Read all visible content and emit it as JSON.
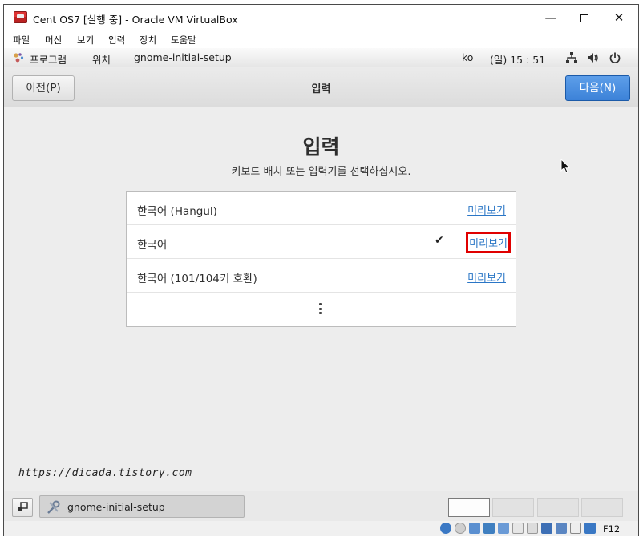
{
  "window": {
    "title": "Cent OS7 [실행 중] - Oracle VM VirtualBox",
    "minimize": "—",
    "close": "✕"
  },
  "menubar": {
    "items": [
      "파일",
      "머신",
      "보기",
      "입력",
      "장치",
      "도움말"
    ]
  },
  "gnome_panel": {
    "applications": "프로그램",
    "places": "위치",
    "active_app": "gnome-initial-setup",
    "input_method": "ko",
    "clock": "(일) 15 : 51",
    "icons": [
      "network-icon",
      "volume-icon",
      "power-icon"
    ]
  },
  "headerbar": {
    "prev_label": "이전(P)",
    "title": "입력",
    "next_label": "다음(N)"
  },
  "page": {
    "heading": "입력",
    "description": "키보드 배치 또는 입력기를 선택하십시오."
  },
  "input_list": [
    {
      "label": "한국어 (Hangul)",
      "preview": "미리보기",
      "selected": false
    },
    {
      "label": "한국어",
      "preview": "미리보기",
      "selected": true
    },
    {
      "label": "한국어 (101/104키 호환)",
      "preview": "미리보기",
      "selected": false
    }
  ],
  "checkmark": "✔",
  "watermark": "https://dicada.tistory.com",
  "taskbar": {
    "item_label": "gnome-initial-setup"
  },
  "statusbar": {
    "host_key": "F12"
  },
  "colors": {
    "accent": "#3c82d8",
    "link": "#2a76c6",
    "highlight": "#e00000"
  }
}
